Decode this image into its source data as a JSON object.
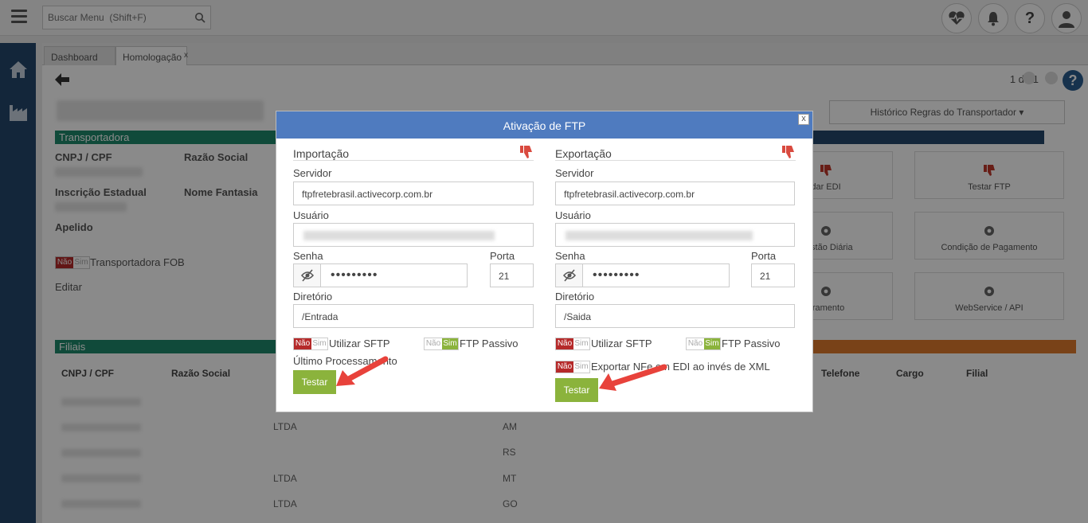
{
  "topbar": {
    "search_placeholder": "Buscar Menu  (Shift+F)"
  },
  "tabs": [
    {
      "label": "Dashboard"
    },
    {
      "label": "Homologação",
      "close": "x"
    }
  ],
  "pager": {
    "text": "1 de 1"
  },
  "background": {
    "section_transportadora": "Transportadora",
    "label_cnpj": "CNPJ / CPF",
    "label_razao": "Razão Social",
    "label_ie": "Inscrição Estadual",
    "label_fantasia": "Nome Fantasia",
    "label_apelido": "Apelido",
    "toggle_no": "Não",
    "toggle_yes": "Sim",
    "transportadora_fob": "Transportadora FOB",
    "editar": "Editar",
    "historico": "Histórico Regras do Transportador ▾",
    "cards": [
      {
        "label": "dar EDI"
      },
      {
        "label": "Testar FTP"
      },
      {
        "label": "Gestão Diária"
      },
      {
        "label": "Condição de Pagamento"
      },
      {
        "label": "uramento"
      },
      {
        "label": "WebService / API"
      }
    ],
    "section_filiais": "Filiais",
    "table_headers": [
      "CNPJ / CPF",
      "Razão Social",
      "Telefone",
      "Cargo",
      "Filial"
    ],
    "table_cells": [
      "LTDA",
      "AM",
      "RS",
      "LTDA",
      "MT",
      "LTDA",
      "GO"
    ]
  },
  "modal": {
    "title": "Ativação de FTP",
    "close": "x",
    "importacao": {
      "title": "Importação",
      "servidor_label": "Servidor",
      "servidor_value": "ftpfretebrasil.activecorp.com.br",
      "usuario_label": "Usuário",
      "senha_label": "Senha",
      "senha_mask": "•••••••••",
      "porta_label": "Porta",
      "porta_value": "21",
      "diretorio_label": "Diretório",
      "diretorio_value": "/Entrada",
      "sftp_label": "Utilizar SFTP",
      "passivo_label": "FTP Passivo",
      "ultimo_label": "Último Processamento",
      "testar": "Testar"
    },
    "exportacao": {
      "title": "Exportação",
      "servidor_label": "Servidor",
      "servidor_value": "ftpfretebrasil.activecorp.com.br",
      "usuario_label": "Usuário",
      "senha_label": "Senha",
      "senha_mask": "•••••••••",
      "porta_label": "Porta",
      "porta_value": "21",
      "diretorio_label": "Diretório",
      "diretorio_value": "/Saida",
      "sftp_label": "Utilizar SFTP",
      "passivo_label": "FTP Passivo",
      "nfe_label": "Exportar NFe em EDI ao invés de XML",
      "testar": "Testar"
    },
    "toggle_no": "Não",
    "toggle_yes": "Sim"
  },
  "colors": {
    "sidebar": "#24476b",
    "modal_header": "#4f7bbf",
    "button_green": "#8bb33c",
    "toggle_red": "#b52a2a",
    "arrow_red": "#e8423b",
    "section_green": "#1f8a6c",
    "section_orange": "#e07b2e"
  }
}
